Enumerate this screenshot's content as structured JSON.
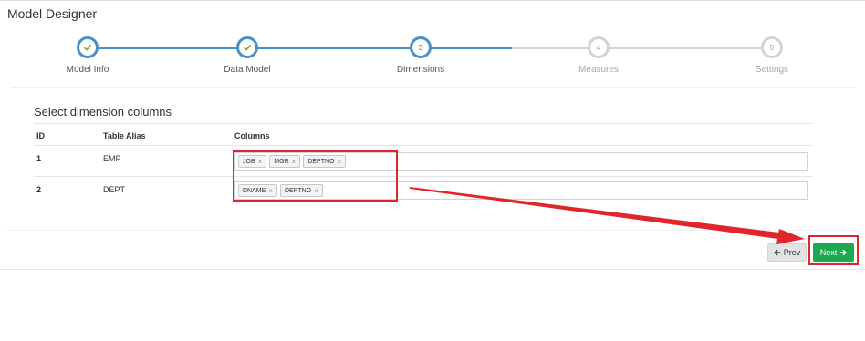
{
  "header": {
    "title": "Model Designer"
  },
  "wizard": {
    "steps": [
      {
        "number": "1",
        "label": "Model Info",
        "status": "done"
      },
      {
        "number": "2",
        "label": "Data Model",
        "status": "done"
      },
      {
        "number": "3",
        "label": "Dimensions",
        "status": "current"
      },
      {
        "number": "4",
        "label": "Measures",
        "status": "todo"
      },
      {
        "number": "5",
        "label": "Settings",
        "status": "todo"
      }
    ]
  },
  "section": {
    "title": "Select dimension columns"
  },
  "table": {
    "headers": {
      "id": "ID",
      "alias": "Table Alias",
      "columns": "Columns"
    },
    "rows": [
      {
        "id": "1",
        "alias": "EMP",
        "columns": [
          "JOB",
          "MGR",
          "DEPTNO"
        ]
      },
      {
        "id": "2",
        "alias": "DEPT",
        "columns": [
          "DNAME",
          "DEPTNO"
        ]
      }
    ],
    "tag_remove_symbol": "×"
  },
  "footer": {
    "prev_label": "Prev",
    "next_label": "Next"
  },
  "colors": {
    "accent": "#4a90c4",
    "success": "#1ea84f",
    "check": "#7cb342",
    "highlight": "#e0262d"
  }
}
